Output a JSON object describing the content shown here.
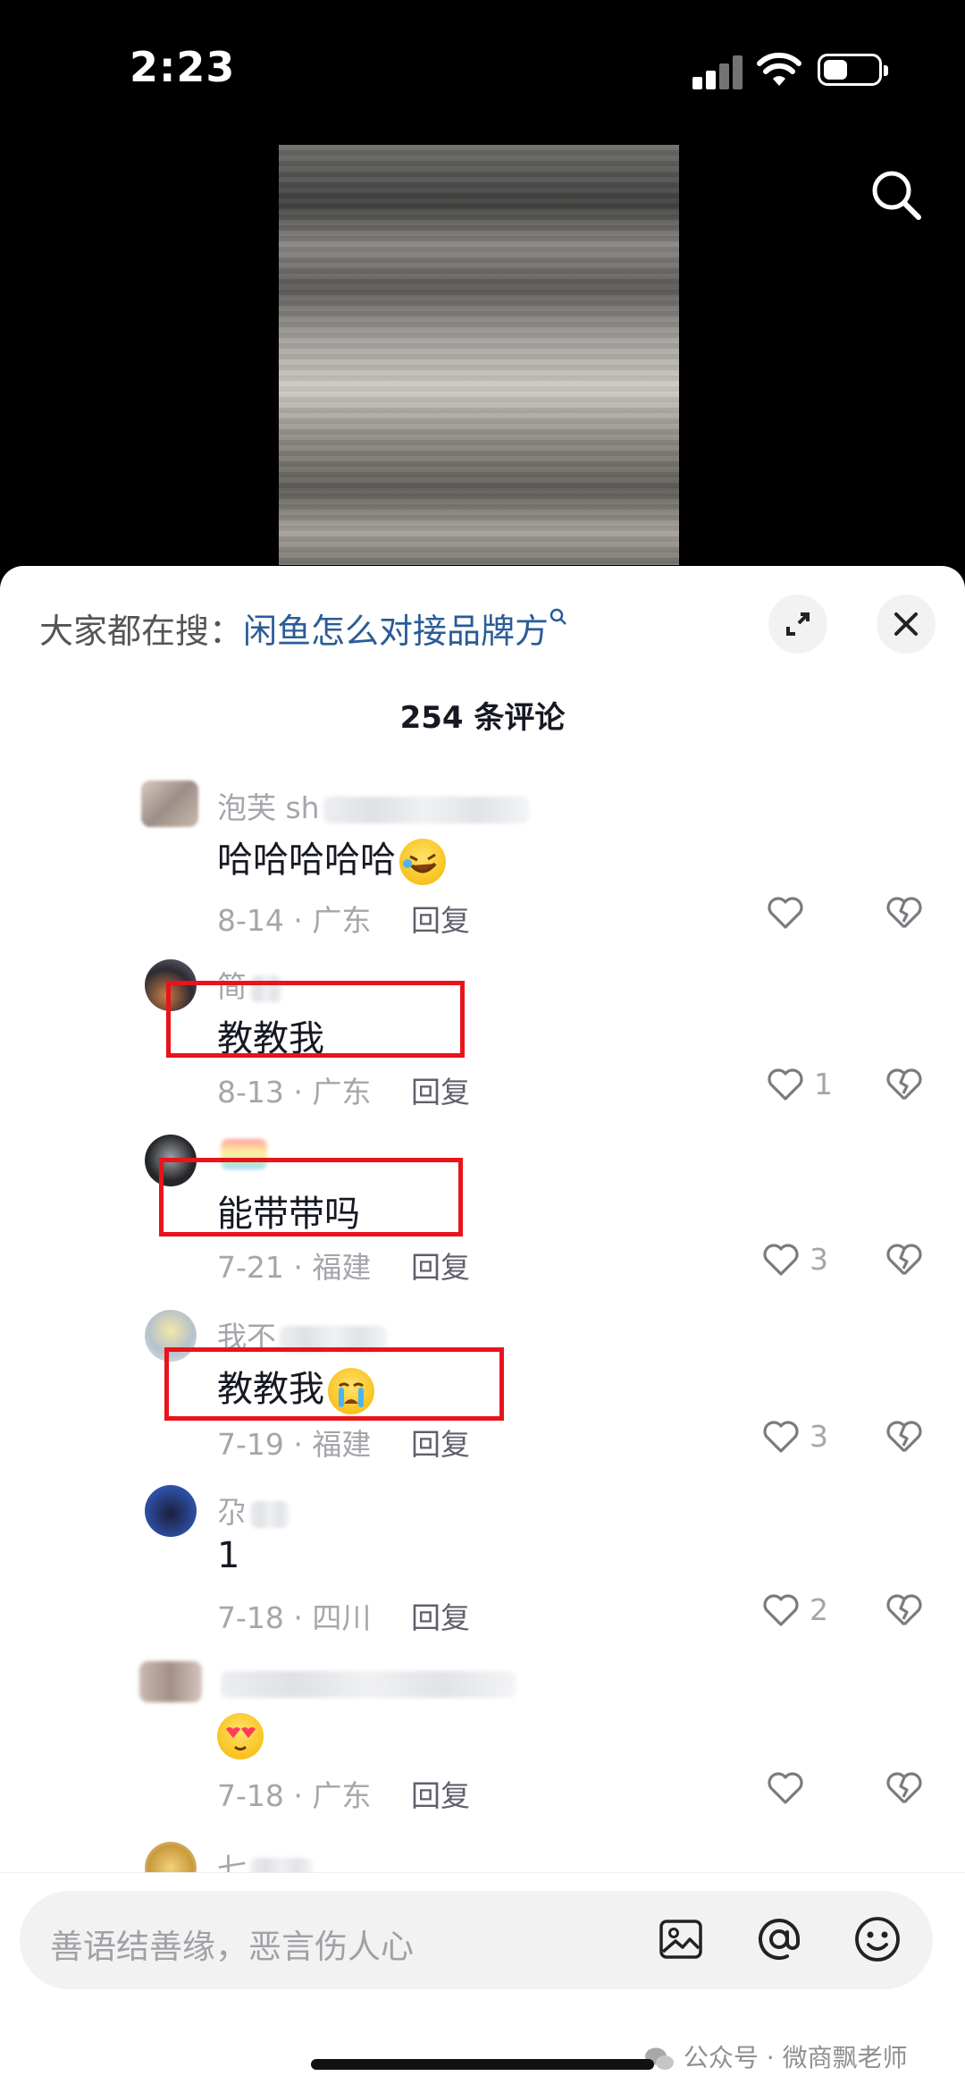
{
  "status": {
    "time": "2:23"
  },
  "sheet": {
    "suggest_prefix": "大家都在搜：",
    "suggest_query": "闲鱼怎么对接品牌方",
    "comment_count": "254 条评论"
  },
  "comments": [
    {
      "user": "泡芙 sh",
      "text": "哈哈哈哈哈",
      "meta": "8-14 · 广东",
      "reply": "回复",
      "likes": ""
    },
    {
      "user": "简",
      "text": "教教我",
      "meta": "8-13 · 广东",
      "reply": "回复",
      "likes": "1"
    },
    {
      "user": "",
      "text": "能带带吗",
      "meta": "7-21 · 福建",
      "reply": "回复",
      "likes": "3"
    },
    {
      "user": "我不",
      "text": "教教我",
      "meta": "7-19 · 福建",
      "reply": "回复",
      "likes": "3"
    },
    {
      "user": "尕",
      "text": "1",
      "meta": "7-18 · 四川",
      "reply": "回复",
      "likes": "2"
    },
    {
      "user": "",
      "text": "",
      "meta": "7-18 · 广东",
      "reply": "回复",
      "likes": ""
    },
    {
      "user": "七",
      "text": "",
      "meta": "",
      "reply": "",
      "likes": ""
    }
  ],
  "input": {
    "placeholder": "善语结善缘，恶言伤人心"
  },
  "watermark": "公众号 · 微商飘老师",
  "icons": [
    "search-icon",
    "expand-icon",
    "close-icon",
    "heart-icon",
    "broken-heart-icon",
    "image-icon",
    "at-icon",
    "emoji-icon"
  ],
  "colors": {
    "highlight_box": "#e8141a",
    "link_query": "#2a5c97",
    "muted_text": "#a5a6ab"
  }
}
